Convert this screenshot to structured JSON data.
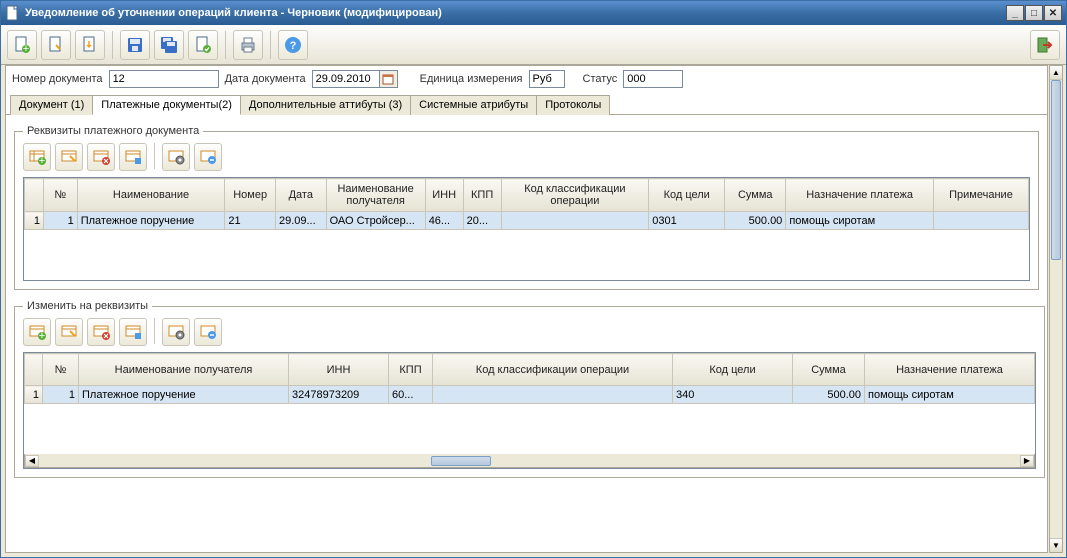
{
  "window": {
    "title": "Уведомление об уточнении операций клиента - Черновик (модифицирован)"
  },
  "form": {
    "doc_number_label": "Номер документа",
    "doc_number": "12",
    "doc_date_label": "Дата документа",
    "doc_date": "29.09.2010",
    "unit_label": "Единица измерения",
    "unit": "Руб",
    "status_label": "Статус",
    "status": "000"
  },
  "tabs": [
    {
      "label": "Документ (1)"
    },
    {
      "label": "Платежные документы(2)"
    },
    {
      "label": "Дополнительные аттибуты (3)"
    },
    {
      "label": "Системные атрибуты"
    },
    {
      "label": "Протоколы"
    }
  ],
  "group1": {
    "legend": "Реквизиты платежного документа",
    "headers": [
      "№",
      "Наименование",
      "Номер",
      "Дата",
      "Наименование получателя",
      "ИНН",
      "КПП",
      "Код классификации операции",
      "Код цели",
      "Сумма",
      "Назначение платежа",
      "Примечание"
    ],
    "row": {
      "idx": "1",
      "num": "1",
      "name": "Платежное поручение",
      "number": "21",
      "date": "29.09...",
      "recipient": "ОАО Стройсер...",
      "inn": "46...",
      "kpp": "20...",
      "classcode": "",
      "goal": "0301",
      "sum": "500.00",
      "purpose": "помощь сиротам",
      "note": ""
    }
  },
  "group2": {
    "legend": "Изменить на реквизиты",
    "headers": [
      "№",
      "Наименование получателя",
      "ИНН",
      "КПП",
      "Код классификации операции",
      "Код цели",
      "Сумма",
      "Назначение платежа"
    ],
    "row": {
      "idx": "1",
      "num": "1",
      "recipient": "Платежное поручение",
      "inn": "32478973209",
      "kpp": "60...",
      "classcode": "",
      "goal": "340",
      "sum": "500.00",
      "purpose": "помощь сиротам"
    }
  }
}
